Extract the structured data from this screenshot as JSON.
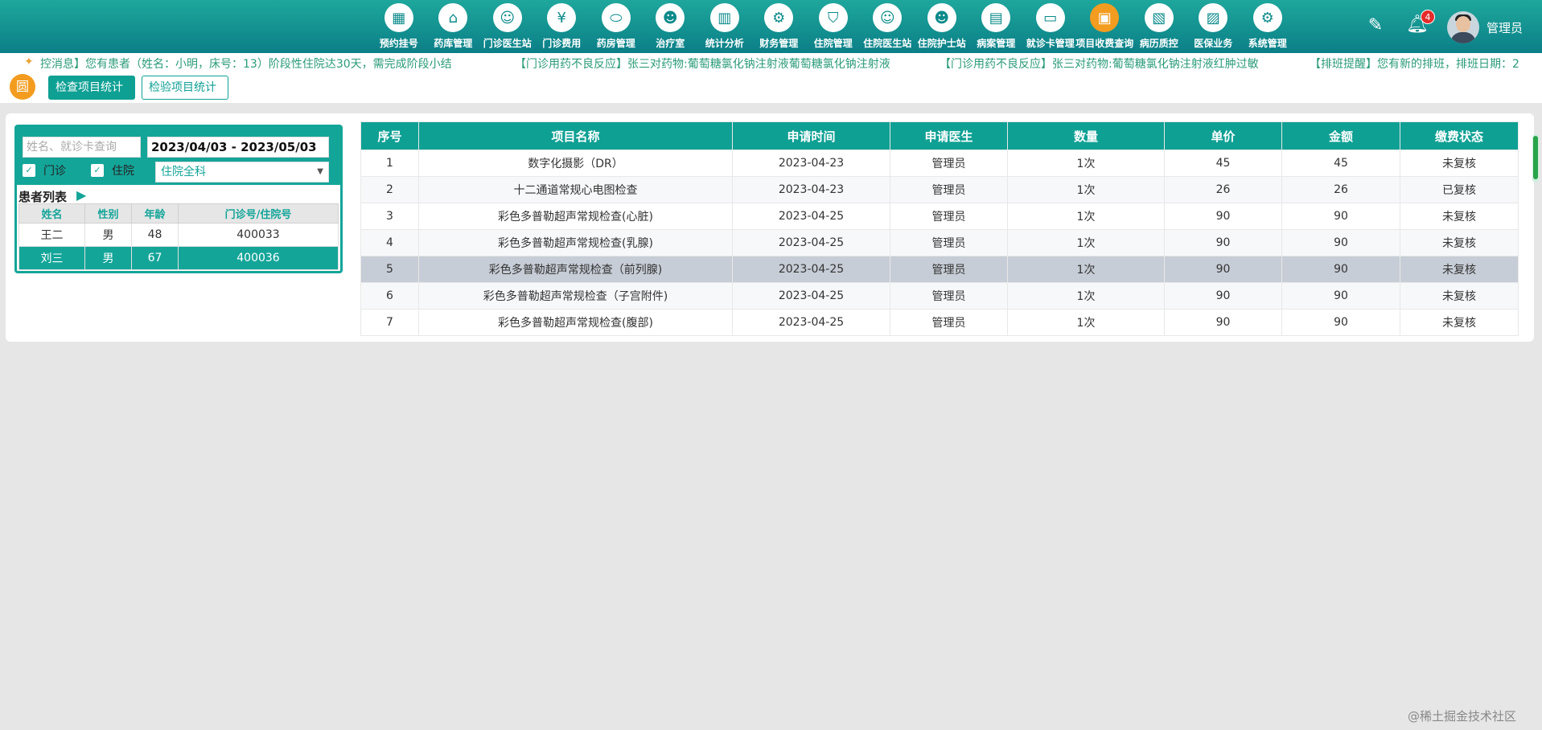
{
  "nav": [
    {
      "label": "预约挂号",
      "icon": "calendar-icon",
      "glyph": "▦"
    },
    {
      "label": "药库管理",
      "icon": "warehouse-icon",
      "glyph": "⌂"
    },
    {
      "label": "门诊医生站",
      "icon": "doctor-icon",
      "glyph": "☺"
    },
    {
      "label": "门诊费用",
      "icon": "yen-icon",
      "glyph": "¥"
    },
    {
      "label": "药房管理",
      "icon": "pill-icon",
      "glyph": "⬭"
    },
    {
      "label": "治疗室",
      "icon": "nurse-icon",
      "glyph": "☻"
    },
    {
      "label": "统计分析",
      "icon": "chart-icon",
      "glyph": "▥"
    },
    {
      "label": "财务管理",
      "icon": "finance-gear-icon",
      "glyph": "⚙"
    },
    {
      "label": "住院管理",
      "icon": "bed-icon",
      "glyph": "⛉"
    },
    {
      "label": "住院医生站",
      "icon": "inpatient-doctor-icon",
      "glyph": "☺"
    },
    {
      "label": "住院护士站",
      "icon": "inpatient-nurse-icon",
      "glyph": "☻"
    },
    {
      "label": "病案管理",
      "icon": "case-file-icon",
      "glyph": "▤"
    },
    {
      "label": "就诊卡管理",
      "icon": "card-icon",
      "glyph": "▭"
    },
    {
      "label": "项目收费查询",
      "icon": "fee-query-icon",
      "glyph": "▣",
      "active": true
    },
    {
      "label": "病历质控",
      "icon": "record-qc-icon",
      "glyph": "▧"
    },
    {
      "label": "医保业务",
      "icon": "insurance-icon",
      "glyph": "▨"
    },
    {
      "label": "系统管理",
      "icon": "settings-icon",
      "glyph": "⚙"
    }
  ],
  "header": {
    "notification_count": "4",
    "username": "管理员",
    "active_color": "#f39c1f",
    "brand_color": "#0fa094"
  },
  "ticker": [
    "控消息】您有患者（姓名：小明，床号：13）阶段性住院达30天，需完成阶段小结",
    "【门诊用药不良反应】张三对药物:葡萄糖氯化钠注射液葡萄糖氯化钠注射液",
    "【门诊用药不良反应】张三对药物:葡萄糖氯化钠注射液红肿过敏",
    "【排班提醒】您有新的排班，排班日期：2"
  ],
  "toolbar": {
    "logo": "圆",
    "tab_exam": "检查项目统计",
    "tab_lab": "检验项目统计"
  },
  "filter": {
    "search_placeholder": "姓名、就诊卡查询",
    "date_range": "2023/04/03 - 2023/05/03",
    "check_outpatient": "门诊",
    "check_inpatient": "住院",
    "dept": "住院全科"
  },
  "patients": {
    "title": "患者列表",
    "columns": [
      "姓名",
      "性别",
      "年龄",
      "门诊号/住院号"
    ],
    "rows": [
      [
        "王二",
        "男",
        "48",
        "400033"
      ],
      [
        "刘三",
        "男",
        "67",
        "400036"
      ]
    ]
  },
  "items": {
    "columns": [
      "序号",
      "项目名称",
      "申请时间",
      "申请医生",
      "数量",
      "单价",
      "金额",
      "缴费状态"
    ],
    "rows": [
      [
        "1",
        "数字化摄影（DR）",
        "2023-04-23",
        "管理员",
        "1次",
        "45",
        "45",
        "未复核"
      ],
      [
        "2",
        "十二通道常规心电图检查",
        "2023-04-23",
        "管理员",
        "1次",
        "26",
        "26",
        "已复核"
      ],
      [
        "3",
        "彩色多普勒超声常规检查(心脏)",
        "2023-04-25",
        "管理员",
        "1次",
        "90",
        "90",
        "未复核"
      ],
      [
        "4",
        "彩色多普勒超声常规检查(乳腺)",
        "2023-04-25",
        "管理员",
        "1次",
        "90",
        "90",
        "未复核"
      ],
      [
        "5",
        "彩色多普勒超声常规检查（前列腺)",
        "2023-04-25",
        "管理员",
        "1次",
        "90",
        "90",
        "未复核"
      ],
      [
        "6",
        "彩色多普勒超声常规检查（子宫附件)",
        "2023-04-25",
        "管理员",
        "1次",
        "90",
        "90",
        "未复核"
      ],
      [
        "7",
        "彩色多普勒超声常规检查(腹部)",
        "2023-04-25",
        "管理员",
        "1次",
        "90",
        "90",
        "未复核"
      ]
    ]
  },
  "watermark": "@稀土掘金技术社区"
}
